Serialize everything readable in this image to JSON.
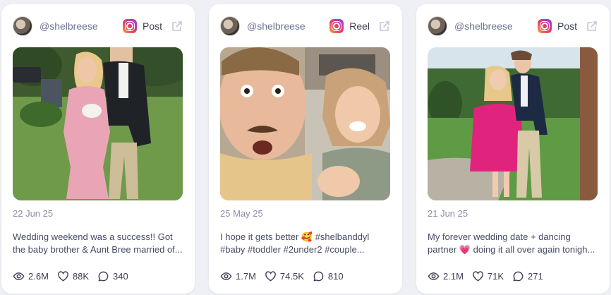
{
  "posts": [
    {
      "handle": "@shelbreese",
      "type": "Post",
      "date": "22 Jun 25",
      "caption": "Wedding weekend was a success!! Got the baby brother & Aunt Bree married of...",
      "views": "2.6M",
      "likes": "88K",
      "comments": "340"
    },
    {
      "handle": "@shelbreese",
      "type": "Reel",
      "date": "25 May 25",
      "caption": "I hope it gets better 🥰 #shelbanddyl #baby #toddler #2under2 #couple...",
      "views": "1.7M",
      "likes": "74.5K",
      "comments": "810"
    },
    {
      "handle": "@shelbreese",
      "type": "Post",
      "date": "21 Jun 25",
      "caption": "My forever wedding date + dancing partner 💗 doing it all over again tonigh...",
      "views": "2.1M",
      "likes": "71K",
      "comments": "271"
    }
  ],
  "icons": {
    "platform": "instagram-icon",
    "external": "external-link-icon",
    "views": "eye-icon",
    "likes": "heart-icon",
    "comments": "comment-icon"
  },
  "colors": {
    "background": "#eef0f5",
    "card": "#ffffff",
    "muted_text": "#8a90a6"
  }
}
